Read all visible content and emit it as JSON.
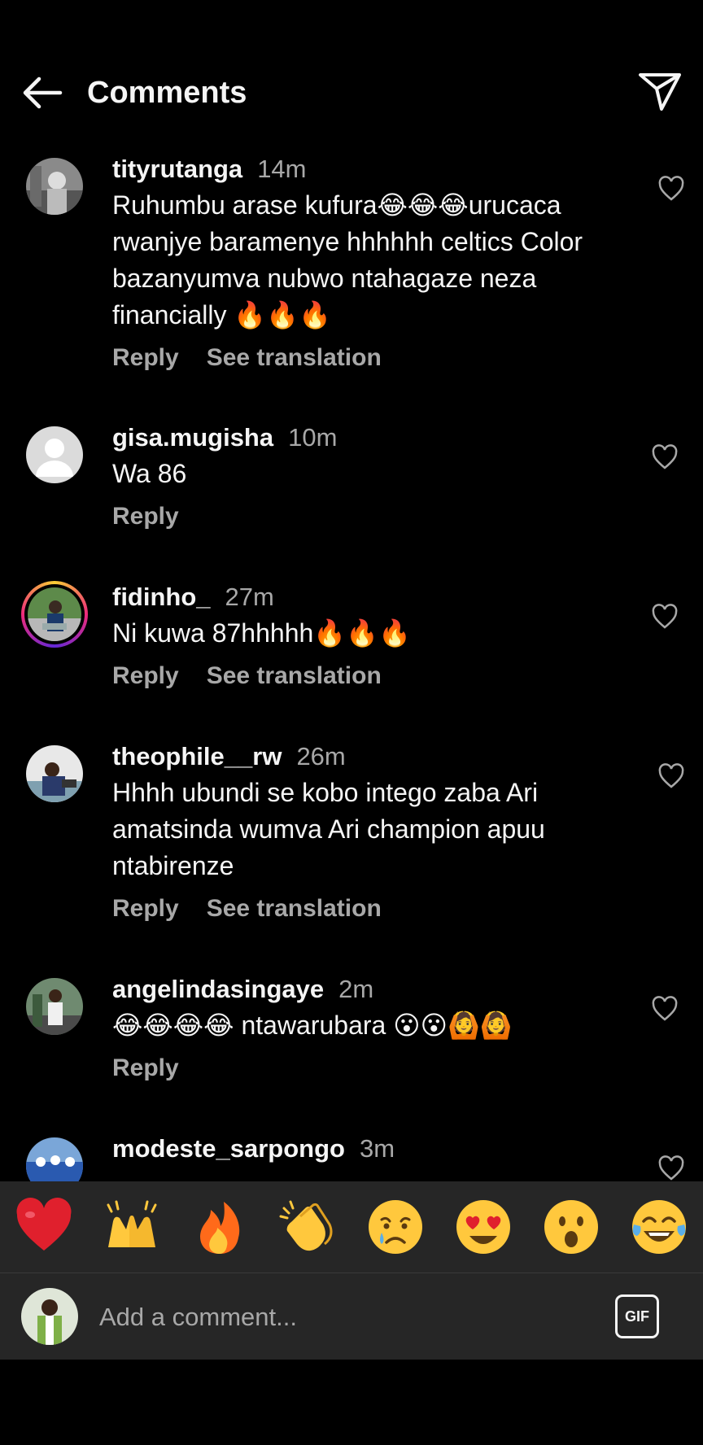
{
  "header": {
    "title": "Comments",
    "back_icon": "arrow-left-icon",
    "send_icon": "paper-plane-icon"
  },
  "actions": {
    "reply": "Reply",
    "translate": "See translation"
  },
  "comments": [
    {
      "username": "tityrutanga",
      "time": "14m",
      "text": "Ruhumbu arase kufura😂😂😂urucaca rwanjye baramenye hhhhhh celtics Color bazanyumva nubwo ntahagaze neza financially 🔥🔥🔥",
      "has_translation": true
    },
    {
      "username": "gisa.mugisha",
      "time": "10m",
      "text": "Wa 86",
      "has_translation": false
    },
    {
      "username": "fidinho_",
      "time": "27m",
      "text": "Ni kuwa 87hhhhh🔥🔥🔥",
      "has_translation": true,
      "story_ring": true
    },
    {
      "username": "theophile__rw",
      "time": "26m",
      "text": "Hhhh ubundi se kobo intego zaba Ari amatsinda wumva Ari champion apuu ntabirenze",
      "has_translation": true
    },
    {
      "username": "angelindasingaye",
      "time": "2m",
      "text": "😂😂😂😂 ntawarubara 😮😮🙆🙆",
      "has_translation": false
    },
    {
      "username": "modeste_sarpongo",
      "time": "3m",
      "text": "",
      "has_translation": false
    }
  ],
  "reactions": [
    "❤️",
    "🙌",
    "🔥",
    "👏",
    "😢",
    "😍",
    "😮",
    "😂"
  ],
  "composer": {
    "placeholder": "Add a comment...",
    "gif_label": "GIF"
  },
  "colors": {
    "background": "#000000",
    "panel": "#262626",
    "secondary_text": "#a8a8a8"
  }
}
